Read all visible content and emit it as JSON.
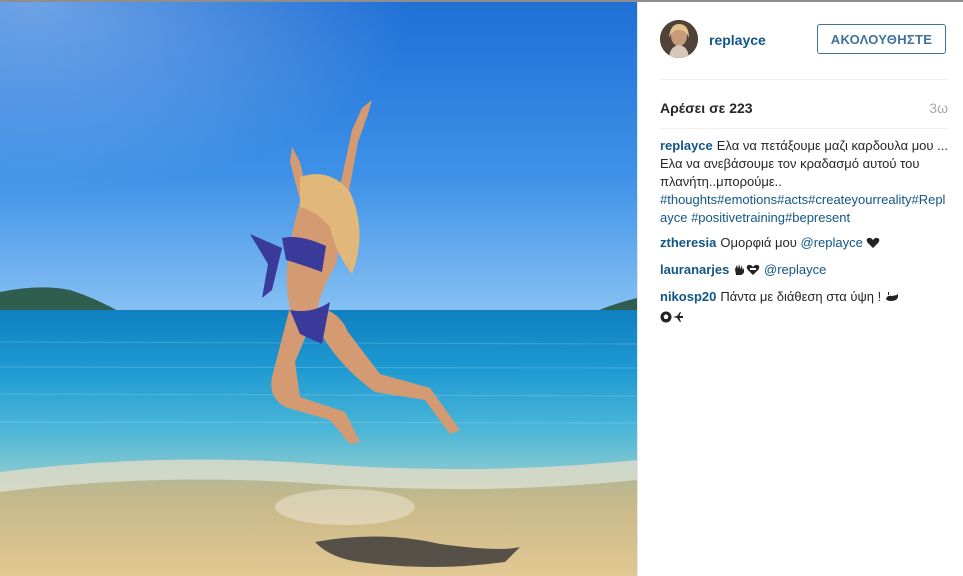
{
  "post": {
    "username": "replayce",
    "follow_label": "ΑΚΟΛΟΥΘΗΣΤΕ",
    "likes": "Αρέσει σε 223",
    "time": "3ω"
  },
  "comments": [
    {
      "user": "replayce",
      "text": "Ελα να πετάξουμε μαζι καρδουλα μου ... Ελα να ανεβάσουμε τον κραδασμό αυτού του πλανήτη..μπορούμε..",
      "tags": "#thoughts#emotions#acts#createyourreality#Replayce #positivetraining#bepresent"
    },
    {
      "user": "ztheresia",
      "text": "Ομορφιά μου",
      "mention": "@replayce"
    },
    {
      "user": "lauranarjes",
      "mention": "@replayce"
    },
    {
      "user": "nikosp20",
      "text": "Πάντα με διάθεση στα ύψη !"
    }
  ],
  "icons": {
    "avatar": "avatar",
    "heart_emoji": "black-heart-icon",
    "hand_emoji": "waving-hand-icon",
    "heart_with_bandage": "heart-icon",
    "whale_emoji": "whale-icon",
    "soccer_emoji": "soccer-ball-icon",
    "plane_emoji": "airplane-icon"
  },
  "colors": {
    "link": "#125688",
    "button_border": "#3f729b",
    "time": "#a5a7aa"
  }
}
